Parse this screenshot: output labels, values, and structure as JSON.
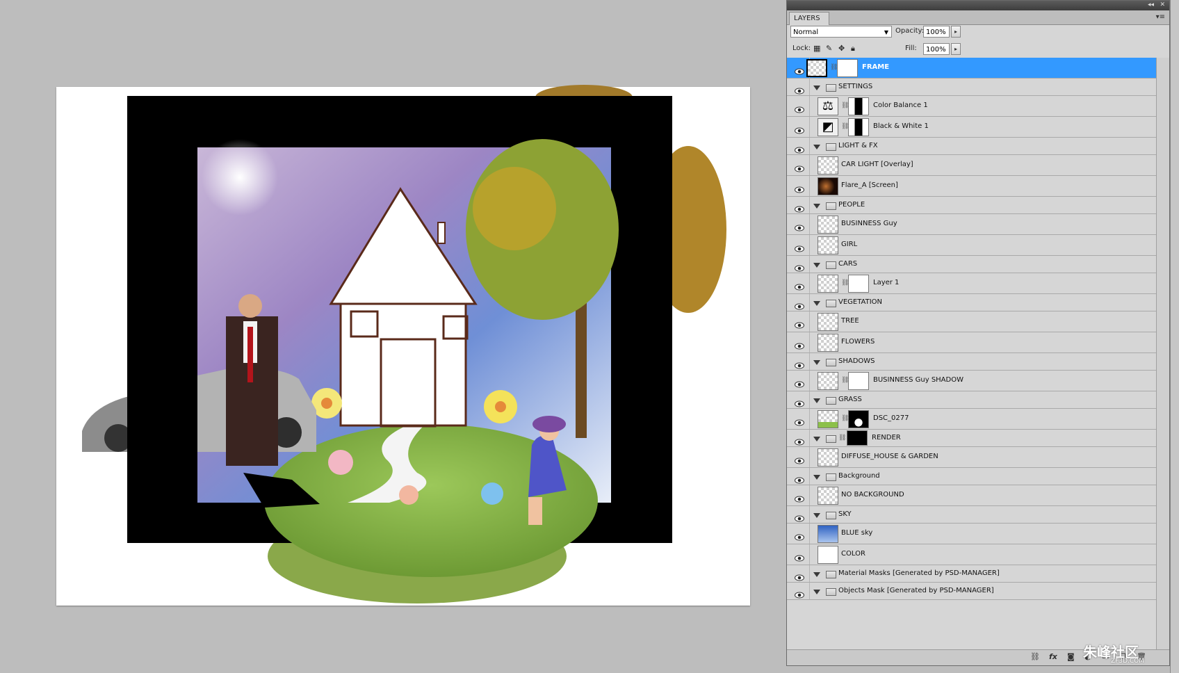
{
  "layers_panel": {
    "tab_label": "LAYERS",
    "blend_mode": "Normal",
    "opacity_label": "Opacity:",
    "opacity_value": "100%",
    "lock_label": "Lock:",
    "fill_label": "Fill:",
    "fill_value": "100%",
    "layers": [
      {
        "name": "FRAME",
        "kind": "layer",
        "indent": 0,
        "mask": true,
        "selected": true
      },
      {
        "name": "SETTINGS",
        "kind": "group",
        "indent": 0
      },
      {
        "name": "Color Balance 1",
        "kind": "adjustment",
        "indent": 1,
        "icon": "balance-icon"
      },
      {
        "name": "Black & White 1",
        "kind": "adjustment",
        "indent": 1,
        "icon": "bw-icon"
      },
      {
        "name": "LIGHT & FX",
        "kind": "group",
        "indent": 0
      },
      {
        "name": "CAR LIGHT [Overlay]",
        "kind": "layer",
        "indent": 1
      },
      {
        "name": "Flare_A [Screen]",
        "kind": "layer",
        "indent": 1,
        "thumb": "dark"
      },
      {
        "name": "PEOPLE",
        "kind": "group",
        "indent": 0
      },
      {
        "name": "BUSINNESS Guy",
        "kind": "layer",
        "indent": 1
      },
      {
        "name": "GIRL",
        "kind": "layer",
        "indent": 1
      },
      {
        "name": "CARS",
        "kind": "group",
        "indent": 0
      },
      {
        "name": "Layer 1",
        "kind": "layer",
        "indent": 1,
        "mask": true
      },
      {
        "name": "VEGETATION",
        "kind": "group",
        "indent": 0
      },
      {
        "name": "TREE",
        "kind": "layer",
        "indent": 1
      },
      {
        "name": "FLOWERS",
        "kind": "layer",
        "indent": 1
      },
      {
        "name": "SHADOWS",
        "kind": "group",
        "indent": 0
      },
      {
        "name": "BUSINNESS Guy SHADOW",
        "kind": "layer",
        "indent": 1,
        "mask": true
      },
      {
        "name": "GRASS",
        "kind": "group",
        "indent": 0
      },
      {
        "name": "DSC_0277",
        "kind": "layer",
        "indent": 1,
        "mask": true,
        "thumb": "green"
      },
      {
        "name": "RENDER",
        "kind": "group-mask",
        "indent": 0
      },
      {
        "name": "DIFFUSE_HOUSE & GARDEN",
        "kind": "layer",
        "indent": 1
      },
      {
        "name": "Background",
        "kind": "group",
        "indent": 0
      },
      {
        "name": "NO BACKGROUND",
        "kind": "layer",
        "indent": 1
      },
      {
        "name": "SKY",
        "kind": "group",
        "indent": 0
      },
      {
        "name": "BLUE sky",
        "kind": "layer",
        "indent": 1,
        "thumb": "blue"
      },
      {
        "name": "COLOR",
        "kind": "layer",
        "indent": 1,
        "thumb": "white"
      },
      {
        "name": "Material Masks [Generated by PSD-MANAGER]",
        "kind": "group",
        "indent": 0
      },
      {
        "name": "Objects Mask [Generated by PSD-MANAGER]",
        "kind": "group",
        "indent": 0
      }
    ],
    "bottom_icons": [
      "link-icon",
      "fx-icon",
      "mask-icon",
      "adjustment-icon",
      "folder-icon",
      "new-layer-icon",
      "trash-icon"
    ]
  },
  "watermark": {
    "text": "朱峰社区",
    "sub": "ZF3D.COM"
  },
  "colors": {
    "selection": "#3399ff",
    "panel_bg": "#d6d6d6",
    "workspace": "#bdbdbd"
  }
}
